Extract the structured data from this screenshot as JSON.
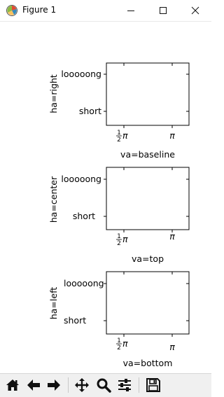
{
  "window": {
    "title": "Figure 1"
  },
  "icons": {
    "app": "matplotlib-figure-icon",
    "minimize": "minimize-icon",
    "maximize": "maximize-icon",
    "close": "close-icon"
  },
  "subplots": [
    {
      "ylabel": "ha=right",
      "xlabel": "va=baseline",
      "yticks": [
        "looooong",
        "short"
      ],
      "xticks": {
        "half_pi_num": "1",
        "half_pi_den": "2",
        "pi": "π"
      }
    },
    {
      "ylabel": "ha=center",
      "xlabel": "va=top",
      "yticks": [
        "looooong",
        "short"
      ],
      "xticks": {
        "half_pi_num": "1",
        "half_pi_den": "2",
        "pi": "π"
      }
    },
    {
      "ylabel": "ha=left",
      "xlabel": "va=bottom",
      "yticks": [
        "looooong",
        "short"
      ],
      "xticks": {
        "half_pi_num": "1",
        "half_pi_den": "2",
        "pi": "π"
      }
    }
  ],
  "toolbar": {
    "home": "home-icon",
    "back": "back-arrow-icon",
    "forward": "forward-arrow-icon",
    "pan": "pan-move-icon",
    "zoom": "zoom-magnifier-icon",
    "configure": "configure-subplots-icon",
    "save": "save-floppy-icon"
  }
}
